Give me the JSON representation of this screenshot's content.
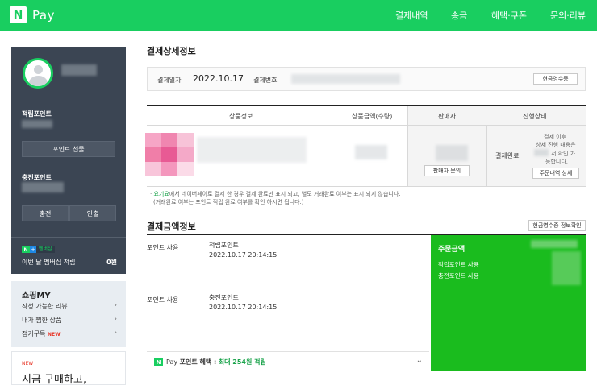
{
  "header": {
    "logo_letter": "N",
    "logo_text": "Pay",
    "nav": [
      "결제내역",
      "송금",
      "혜택·쿠폰",
      "문의·리뷰"
    ]
  },
  "sidebar": {
    "points_label": "적립포인트",
    "point_gift_button": "포인트 선물",
    "charge_points_label": "충전포인트",
    "charge_button": "충전",
    "withdraw_button": "인출",
    "membership_badge": {
      "n": "N",
      "plus": "+",
      "text": "멤버십"
    },
    "monthly_label": "이번 달 멤버십 적립",
    "monthly_value": "0원"
  },
  "shopping": {
    "title": "쇼핑MY",
    "items": [
      {
        "label": "작성 가능한 리뷰",
        "new": ""
      },
      {
        "label": "내가 찜한 상품",
        "new": ""
      },
      {
        "label": "정기구독",
        "new": "NEW"
      }
    ]
  },
  "promo": {
    "new": "NEW",
    "text": "지금 구매하고,"
  },
  "detail": {
    "title": "결제상세정보",
    "date_label": "결제일자",
    "date_value": "2022.10.17",
    "number_label": "결제번호",
    "receipt_button": "현금영수증"
  },
  "table": {
    "headers": [
      "상품정보",
      "상품금액(수량)",
      "판매자",
      "진행상태"
    ],
    "seller_button": "판매자 문의",
    "status": "결제완료",
    "status_note": [
      "결제 이후",
      "상세 진행 내용은",
      "서 확인 가",
      "능합니다."
    ],
    "order_detail_button": "주문내역 상세"
  },
  "notes": {
    "line1_link": "요기요",
    "line1_rest": "에서 네이버페이로 결제 한 경우 결제 완료만 표시 되고, 별도 거래완료 여부는 표시 되지 않습니다.",
    "line2": "(거래완료 여부는 포인트 적립 완료 여부를 확인 하시면 됩니다.)"
  },
  "amount": {
    "title": "결제금액정보",
    "receipt_info_button": "현금영수증 정보확인",
    "rows": [
      {
        "label": "포인트 사용",
        "type": "적립포인트",
        "datetime": "2022.10.17 20:14:15"
      },
      {
        "label": "포인트 사용",
        "type": "충전포인트",
        "datetime": "2022.10.17 20:14:15"
      }
    ],
    "order_amount_label": "주문금액",
    "order_rows": [
      "적립포인트 사용",
      "충전포인트 사용"
    ]
  },
  "benefit": {
    "n": "N",
    "pay": "Pay",
    "label": "포인트 혜택 :",
    "value": "최대 254원 적립"
  },
  "colors": {
    "brand_green": "#19ce60",
    "sidebar": "#3b4553",
    "panel_green": "#1abc1e"
  }
}
